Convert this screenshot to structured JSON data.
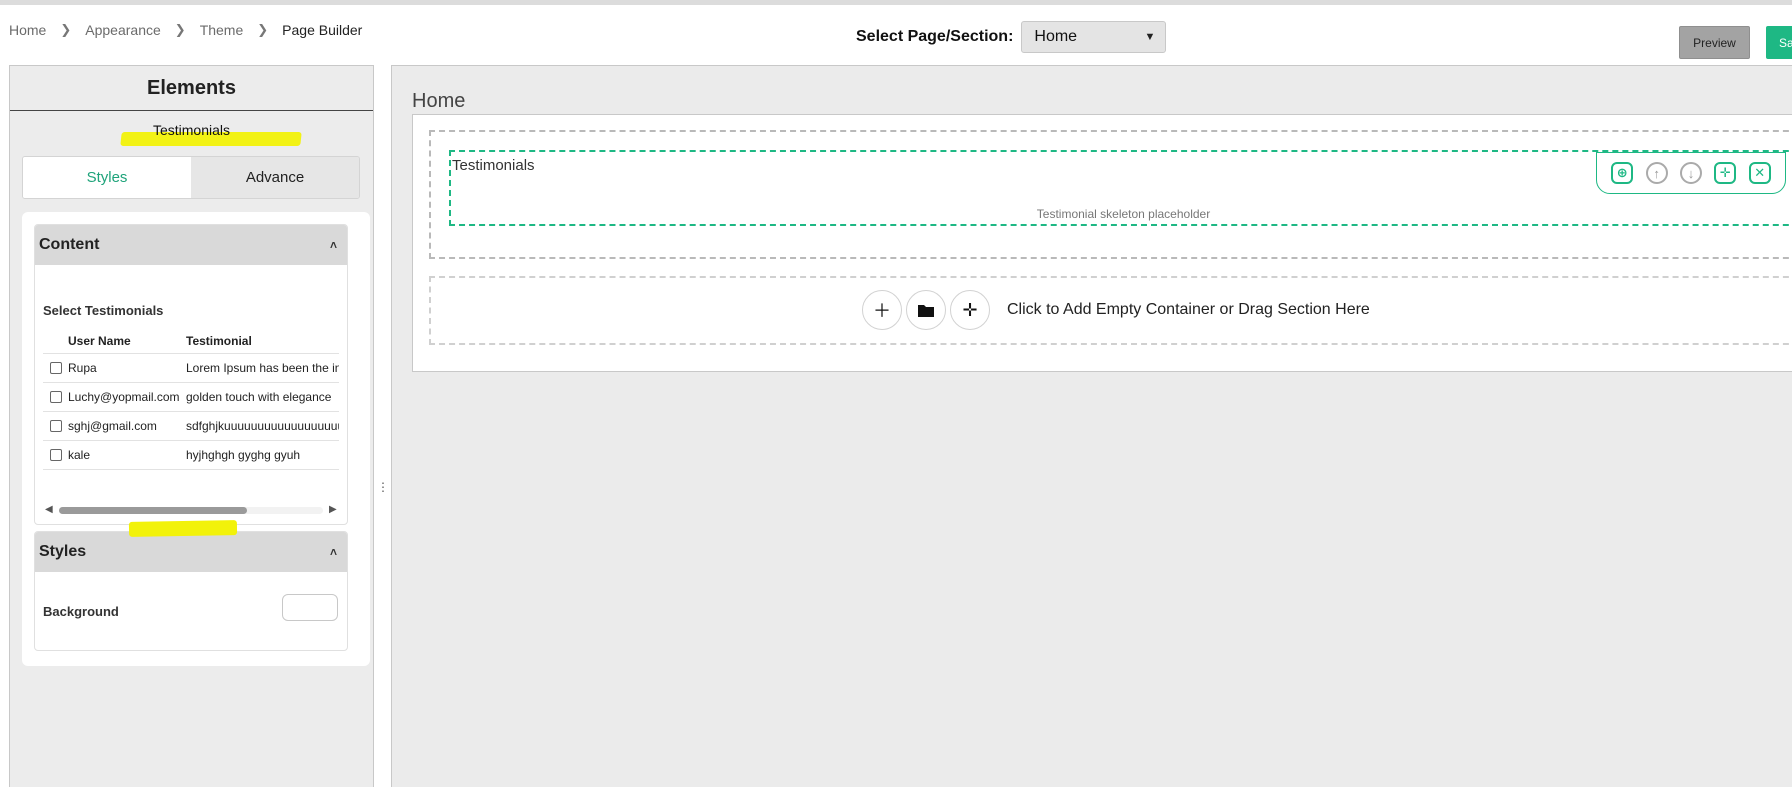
{
  "breadcrumb": [
    "Home",
    "Appearance",
    "Theme",
    "Page Builder"
  ],
  "header": {
    "select_label": "Select Page/Section:",
    "select_value": "Home",
    "preview_label": "Preview",
    "save_label": "Save"
  },
  "left_panel": {
    "title": "Elements",
    "element_name": "Testimonials",
    "tabs": [
      {
        "label": "Styles",
        "active": true
      },
      {
        "label": "Advance",
        "active": false
      }
    ],
    "content_section": {
      "title": "Content",
      "select_label": "Select Testimonials",
      "columns": [
        "User Name",
        "Testimonial"
      ],
      "rows": [
        {
          "user": "Rupa",
          "testimonial": "Lorem Ipsum has been the in"
        },
        {
          "user": "Luchy@yopmail.com",
          "testimonial": "golden touch with elegance"
        },
        {
          "user": "sghj@gmail.com",
          "testimonial": "sdfghjkuuuuuuuuuuuuuuuuuu"
        },
        {
          "user": "kale",
          "testimonial": "hyjhghgh gyghg gyuh"
        }
      ]
    },
    "styles_section": {
      "title": "Styles",
      "background_label": "Background"
    }
  },
  "canvas": {
    "title": "Home",
    "testimonial_block_title": "Testimonials",
    "skeleton_text": "Testimonial skeleton placeholder",
    "add_container_text": "Click to Add Empty Container or Drag Section Here"
  },
  "colors": {
    "accent": "#1eb884",
    "highlight": "#f2f20a",
    "preview_button": "#a3a3a3"
  },
  "icons": {
    "toolbar": [
      "duplicate-icon",
      "move-up-icon",
      "move-down-icon",
      "drag-icon",
      "close-icon"
    ],
    "add_buttons": [
      "plus-icon",
      "folder-icon",
      "move-icon"
    ]
  }
}
